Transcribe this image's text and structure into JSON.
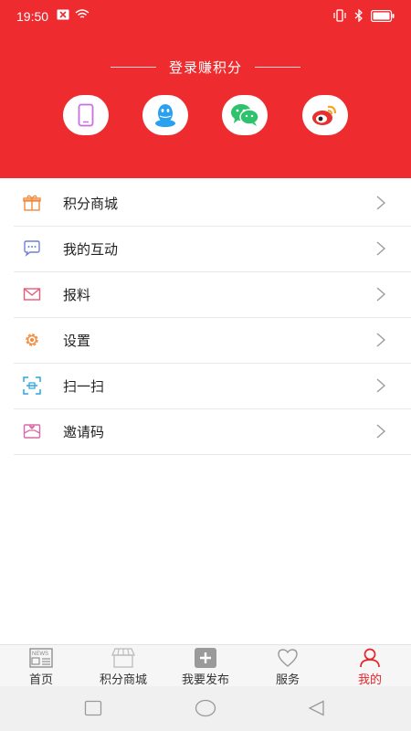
{
  "status_bar": {
    "time": "19:50",
    "left_icons": [
      "notification-x-icon",
      "wifi-icon"
    ],
    "right_icons": [
      "vibrate-icon",
      "bluetooth-icon",
      "battery-icon"
    ]
  },
  "header": {
    "login_title": "登录赚积分",
    "background_color": "#ee2b2f",
    "social_logins": [
      "phone-icon",
      "qq-icon",
      "wechat-icon",
      "weibo-icon"
    ]
  },
  "menu": {
    "items": [
      {
        "label": "积分商城",
        "icon": "gift-icon"
      },
      {
        "label": "我的互动",
        "icon": "chat-bubble-icon"
      },
      {
        "label": "报料",
        "icon": "mail-icon"
      },
      {
        "label": "设置",
        "icon": "gear-icon"
      },
      {
        "label": "扫一扫",
        "icon": "scan-icon"
      },
      {
        "label": "邀请码",
        "icon": "invite-envelope-icon"
      }
    ]
  },
  "tabbar": {
    "active_color": "#e8232a",
    "tabs": [
      {
        "label": "首页",
        "icon": "news-icon",
        "active": false
      },
      {
        "label": "积分商城",
        "icon": "store-icon",
        "active": false
      },
      {
        "label": "我要发布",
        "icon": "plus-icon",
        "active": false
      },
      {
        "label": "服务",
        "icon": "heart-icon",
        "active": false
      },
      {
        "label": "我的",
        "icon": "user-icon",
        "active": true
      }
    ]
  },
  "system_nav": [
    "recent-apps-icon",
    "home-icon",
    "back-icon"
  ]
}
